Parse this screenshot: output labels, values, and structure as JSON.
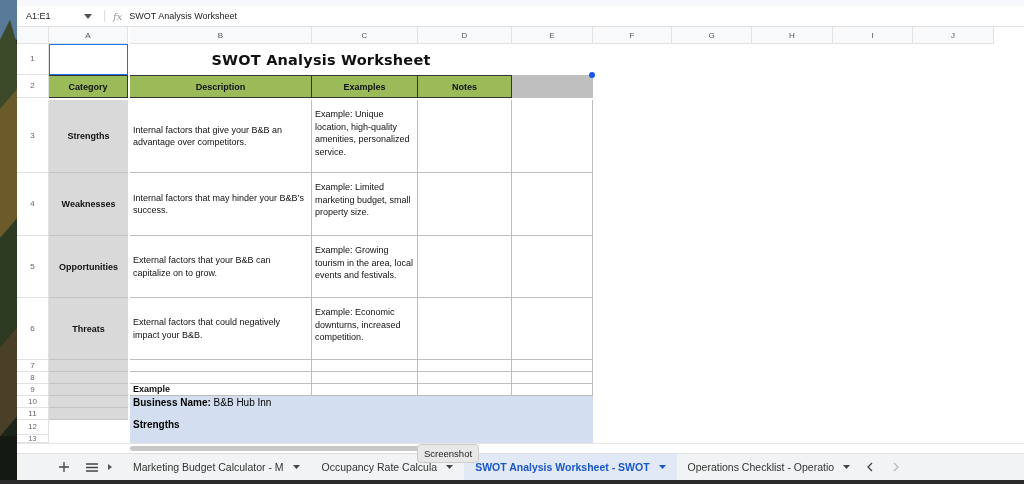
{
  "formula_bar": {
    "cell_ref": "A1:E1",
    "fx": "fx",
    "formula": "SWOT Analysis Worksheet"
  },
  "columns": [
    "A",
    "B",
    "C",
    "D",
    "E",
    "F",
    "G",
    "H",
    "I",
    "J"
  ],
  "rows": [
    "1",
    "2",
    "3",
    "4",
    "5",
    "6",
    "7",
    "8",
    "9",
    "10",
    "11",
    "12",
    "13"
  ],
  "sheet": {
    "title": "SWOT Analysis Worksheet",
    "headers": [
      "Category",
      "Description",
      "Examples",
      "Notes"
    ],
    "items": [
      {
        "category": "Strengths",
        "description": "Internal factors that give your B&B an advantage over competitors.",
        "examples": "Example: Unique location, high-quality amenities, personalized service."
      },
      {
        "category": "Weaknesses",
        "description": "Internal factors that may hinder your B&B’s success.",
        "examples": "Example: Limited marketing budget, small property size."
      },
      {
        "category": "Opportunities",
        "description": "External factors that your B&B can capitalize on to grow.",
        "examples": "Example: Growing tourism in the area, local events and festivals."
      },
      {
        "category": "Threats",
        "description": "External factors that could negatively impact your B&B.",
        "examples": "Example: Economic downturns, increased competition."
      }
    ],
    "example_label": "Example",
    "business_line": "**Business Name:** B&B Hub Inn",
    "section": "Strengths"
  },
  "tabs": [
    {
      "label": "Marketing Budget Calculator - M",
      "selected": false
    },
    {
      "label": "Occupancy Rate Calcula",
      "selected": false
    },
    {
      "label": "SWOT Analysis Worksheet - SWOT",
      "selected": true
    },
    {
      "label": "Operations Checklist - Operatio",
      "selected": false
    }
  ],
  "tooltip": {
    "text": "Screenshot"
  }
}
